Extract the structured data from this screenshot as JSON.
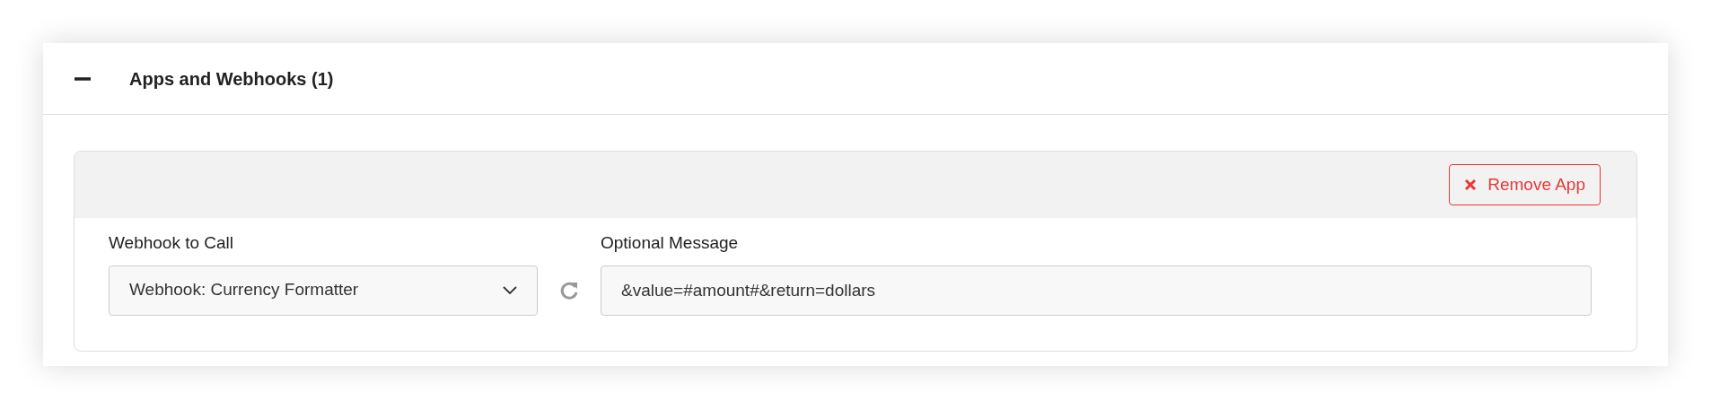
{
  "section": {
    "title": "Apps and Webhooks (1)",
    "expanded": true
  },
  "app": {
    "remove_button": "Remove App",
    "webhook": {
      "label": "Webhook to Call",
      "value": "Webhook: Currency Formatter"
    },
    "message": {
      "label": "Optional Message",
      "value": "&value=#amount#&return=dollars"
    }
  }
}
